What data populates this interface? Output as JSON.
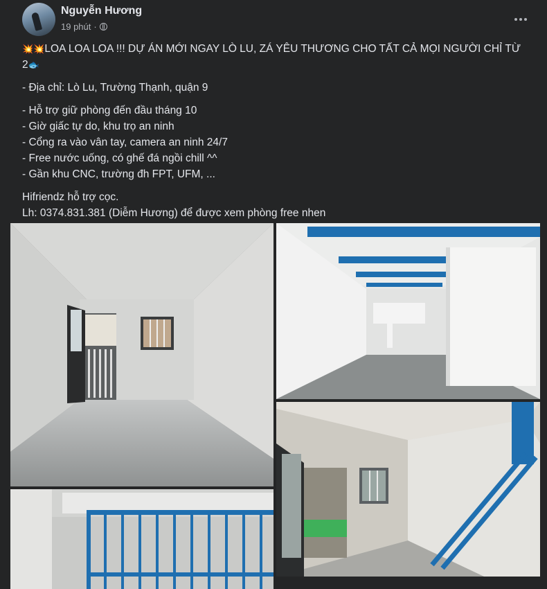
{
  "post": {
    "author": "Nguyễn Hương",
    "time": "19 phút",
    "separator": "·",
    "title_emoji": "💥💥",
    "title": "LOA LOA LOA !!! DỰ ÁN MỚI NGAY LÒ LU, ZÁ YÊU THƯƠNG CHO TẤT CẢ MỌI NGƯỜI CHỈ TỪ 2",
    "title_end_emoji": "🐟",
    "address": "- Địa chỉ: Lò Lu, Trường Thạnh, quận 9",
    "features": [
      "- Hỗ trợ giữ phòng đến đầu tháng 10",
      "- Giờ giấc tự do, khu trọ an ninh",
      "- Cổng ra vào vân tay, camera an ninh 24/7",
      "- Free nước uống, có ghế đá ngồi chill ^^",
      "- Gần khu CNC, trường đh FPT, UFM, ..."
    ],
    "contact_1": "Hifriendz hỗ trợ cọc.",
    "contact_2": "Lh: 0374.831.381 (Diễm Hương) để được xem phòng free nhen"
  },
  "icons": {
    "globe": "globe-icon",
    "more": "more-options-icon"
  },
  "colors": {
    "card_bg": "#242526",
    "text": "#e4e6eb",
    "secondary_text": "#b0b3b8",
    "beam_blue": "#1f6fb0"
  }
}
